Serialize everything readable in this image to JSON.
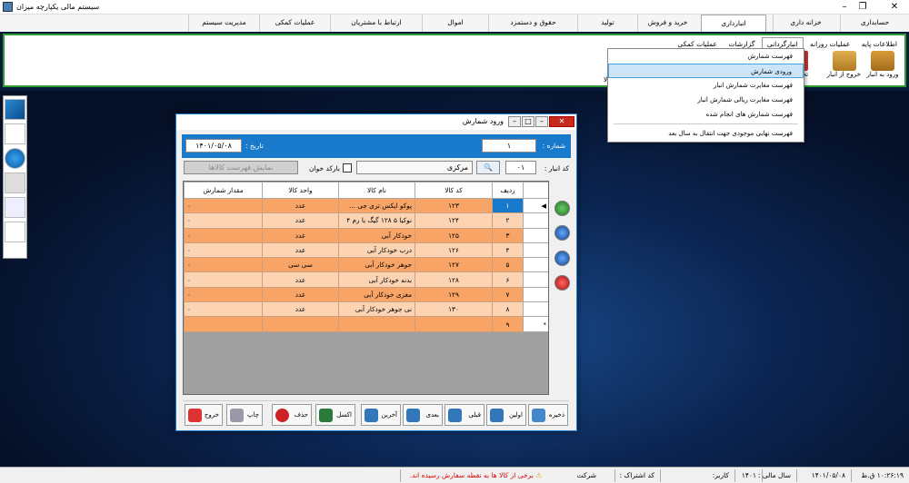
{
  "app": {
    "title": "سیستم مالی یکپارچه میزان"
  },
  "menubar": [
    "حسابداری",
    "خزانه داری",
    "انبارداری",
    "خرید و فروش",
    "تولید",
    "حقوق و دستمزد",
    "اموال",
    "ارتباط با مشتریان",
    "عملیات کمکی",
    "مدیریت سیستم"
  ],
  "ribbon": {
    "tabs": [
      "اطلاعات پایه",
      "عملیات روزانه",
      "انبارگردانی",
      "گزارشات",
      "عملیات کمکی"
    ],
    "buttons": [
      "ورود به انبار",
      "خروج از انبار",
      "تحو"
    ],
    "truncated_text": "لا"
  },
  "dropdown": {
    "items": [
      "فهرست شمارش",
      "ورودی شمارش",
      "فهرست مغایرت شمارش انبار",
      "فهرست مغایرت ریالی شمارش انبار",
      "فهرست شمارش های انجام شده",
      "فهرست نهایی موجودی جهت انتقال به سال بعد"
    ],
    "selected_index": 1
  },
  "window": {
    "title": "ورود شمارش",
    "number_label": "شماره :",
    "number_value": "۱",
    "date_label": "تاریخ :",
    "date_value": "۱۴۰۱/۰۵/۰۸",
    "warehouse_label": "کد انبار :",
    "warehouse_code": "۰۱",
    "warehouse_name": "مرکزی",
    "barcode_label": "بارکد خوان",
    "show_list_button": "نمایش فهرست کالاها",
    "columns": [
      "ردیف",
      "کد کالا",
      "نام کالا",
      "واحد کالا",
      "مقدار شمارش"
    ],
    "rows": [
      {
        "row": "۱",
        "code": "۱۲۳",
        "name": "پوکو ایکس تری جی ...",
        "unit": "عدد",
        "qty": "۰"
      },
      {
        "row": "۲",
        "code": "۱۲۴",
        "name": "نوکیا ۵ ۱۲۸ گیگ با رم ۴",
        "unit": "عدد",
        "qty": "۰"
      },
      {
        "row": "۳",
        "code": "۱۲۵",
        "name": "خودکار آبی",
        "unit": "عدد",
        "qty": "۰"
      },
      {
        "row": "۴",
        "code": "۱۲۶",
        "name": "درب خودکار آبی",
        "unit": "عدد",
        "qty": "۰"
      },
      {
        "row": "۵",
        "code": "۱۲۷",
        "name": "جوهر خودکار آبی",
        "unit": "سی سی",
        "qty": "۰"
      },
      {
        "row": "۶",
        "code": "۱۲۸",
        "name": "بدنه خودکار آبی",
        "unit": "عدد",
        "qty": "۰"
      },
      {
        "row": "۷",
        "code": "۱۲۹",
        "name": "مغزی خودکار آبی",
        "unit": "عدد",
        "qty": "۰"
      },
      {
        "row": "۸",
        "code": "۱۳۰",
        "name": "نی جوهر خودکار آبی",
        "unit": "عدد",
        "qty": "۰"
      },
      {
        "row": "۹",
        "code": "",
        "name": "",
        "unit": "",
        "qty": ""
      }
    ],
    "bottom_buttons": [
      "ذخیره",
      "اولین",
      "قبلی",
      "بعدی",
      "آخرین",
      "اکسل",
      "حذف",
      "چاپ",
      "خروج"
    ]
  },
  "statusbar": {
    "time": "۱۰:۲۶:۱۹ ق.ظ",
    "date": "۱۴۰۱/۰۵/۰۸",
    "fiscal_label": "سال مالی :",
    "fiscal_value": "۱۴۰۱",
    "user_label": "کاربر:",
    "subscription_label": "کد اشتراک :",
    "company_label": "شرکت",
    "warning": "برخی از کالا ها به نقطه سفارش رسیده اند."
  },
  "colors": {
    "accent": "#1979ca",
    "ribbon_border": "#2e9c2e",
    "row_odd": "#f8a466",
    "row_even": "#fcd4b4"
  }
}
